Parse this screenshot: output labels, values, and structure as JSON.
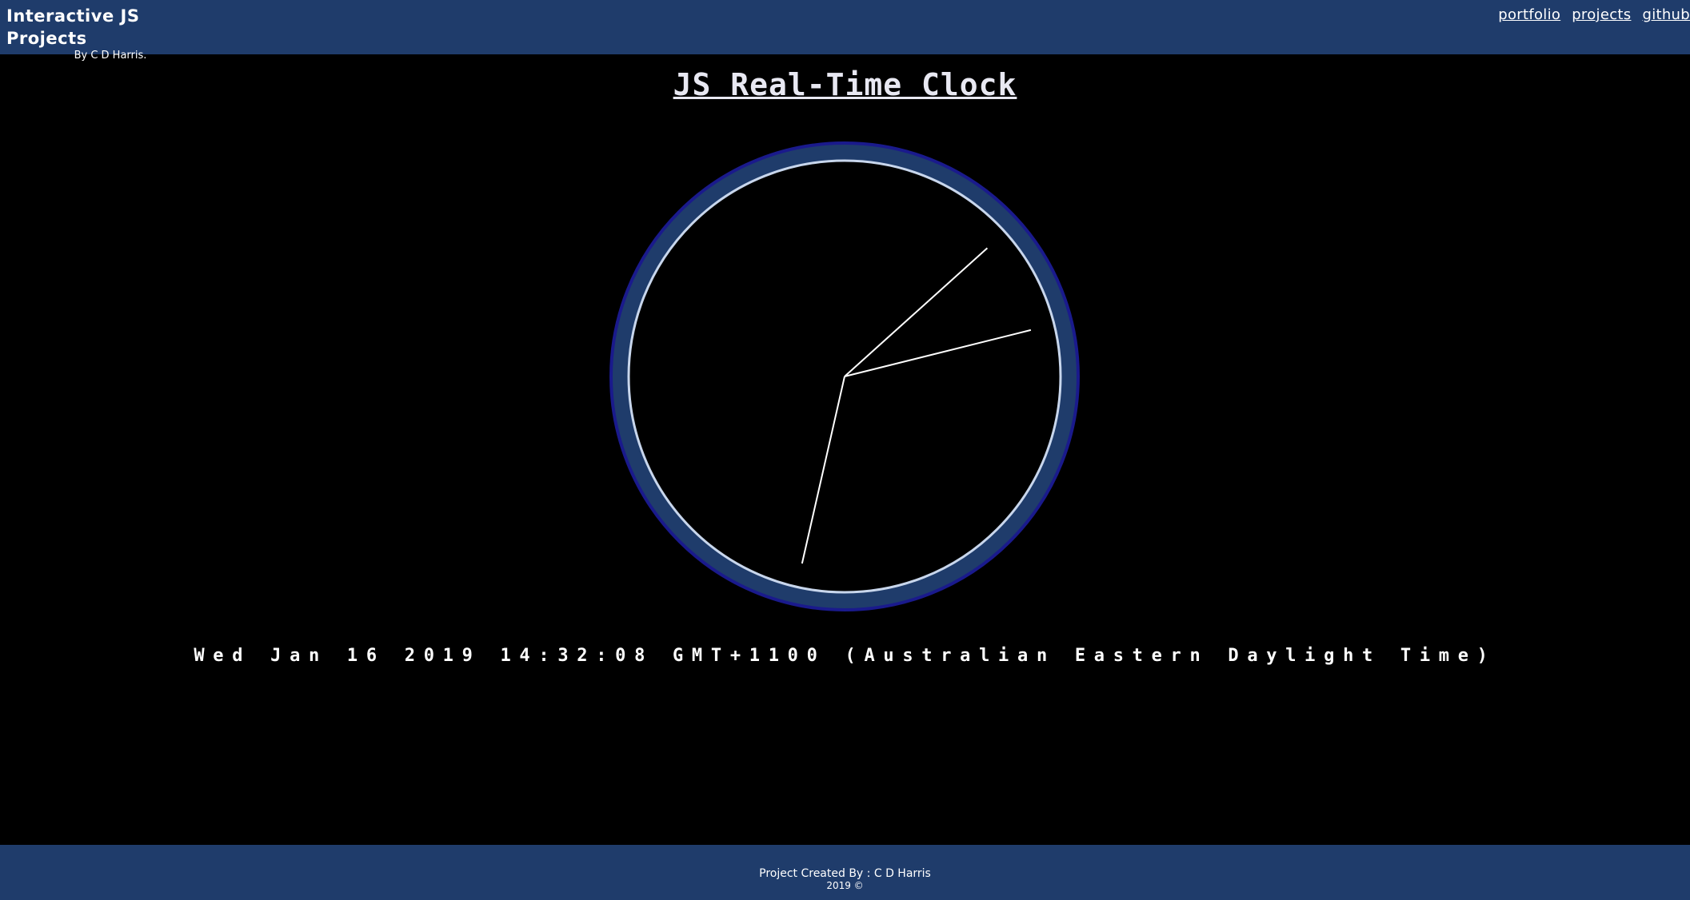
{
  "header": {
    "title": "Interactive JS Projects",
    "subtitle": "By C D Harris.",
    "nav": [
      {
        "label": "portfolio"
      },
      {
        "label": "projects"
      },
      {
        "label": "github"
      }
    ]
  },
  "main": {
    "title": "JS Real-Time Clock",
    "datetime": "Wed Jan 16 2019 14:32:08 GMT+1100 (Australian Eastern Daylight Time)",
    "clock": {
      "hour": 14,
      "minute": 32,
      "second": 8,
      "colors": {
        "ring": "#1f3c6b",
        "ring_border": "#1a1a8c",
        "inner_border": "#c8d6ec",
        "hands": "#ffffff"
      }
    }
  },
  "footer": {
    "credit": "Project Created By : C D Harris",
    "year": "2019 ©"
  },
  "colors": {
    "bar_background": "#1f3c6b",
    "page_background": "#000000",
    "text": "#ffffff"
  }
}
